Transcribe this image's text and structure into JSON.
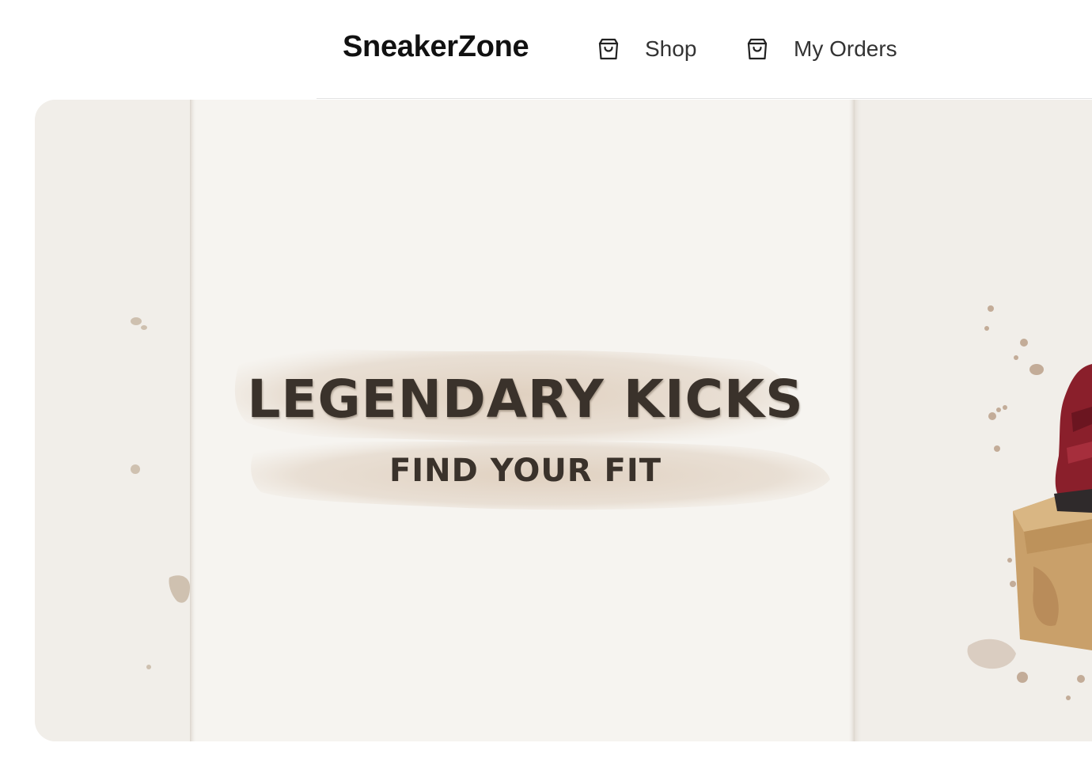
{
  "header": {
    "brand": "SneakerZone",
    "nav": [
      {
        "label": "Shop",
        "icon": "shopping-bag-icon"
      },
      {
        "label": "My Orders",
        "icon": "shopping-bag-icon"
      }
    ]
  },
  "hero": {
    "title": "LEGENDARY KICKS",
    "subtitle": "FIND YOUR FIT"
  },
  "colors": {
    "text_dark": "#111111",
    "nav_text": "#333333",
    "hero_paper": "#f3f0ec",
    "hero_text": "#3a322b",
    "sneaker_red": "#8a1f2b",
    "shoebox": "#c9a06a"
  }
}
